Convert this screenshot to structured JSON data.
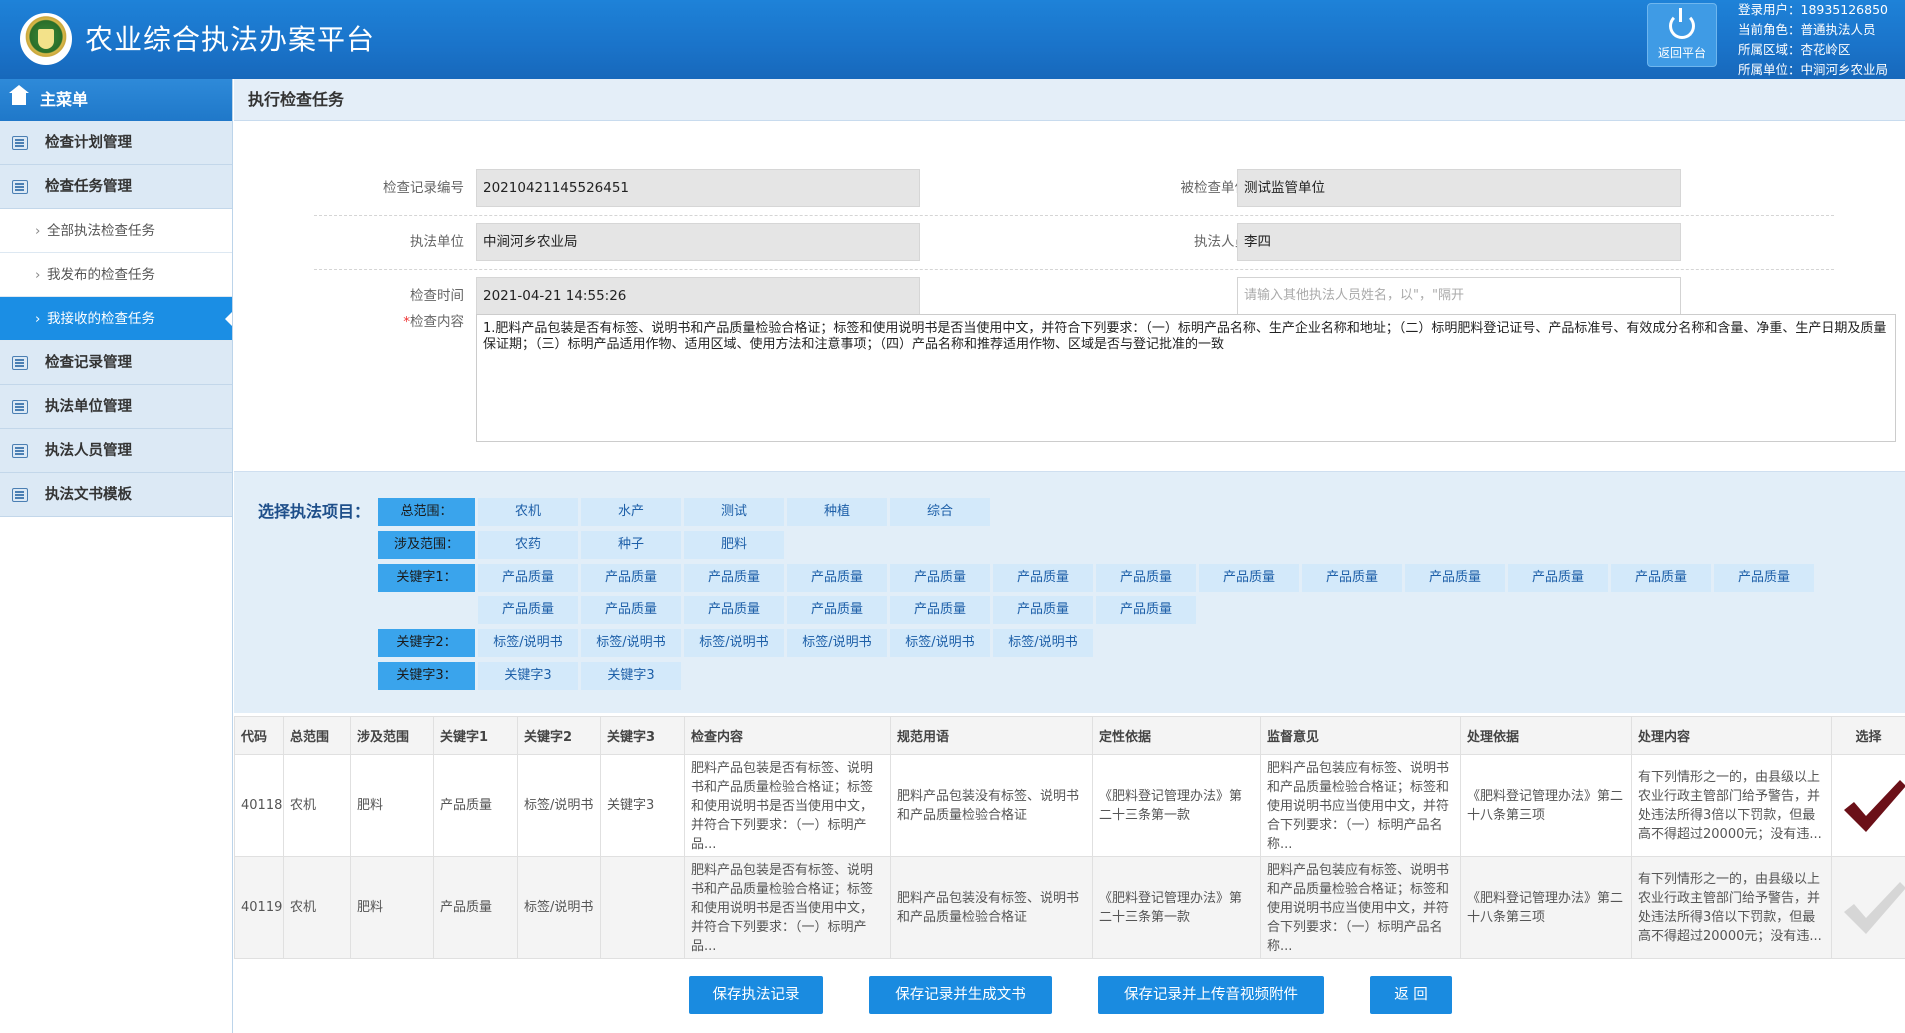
{
  "header": {
    "app_title": "农业综合执法办案平台",
    "return_label": "返回平台",
    "user_lines": [
      "登录用户：18935126850",
      "当前角色：普通执法人员",
      "所属区域：杏花岭区",
      "所属单位：中涧河乡农业局"
    ]
  },
  "sidebar": {
    "menu_title": "主菜单",
    "items": [
      {
        "label": "检查计划管理"
      },
      {
        "label": "检查任务管理"
      },
      {
        "label": "全部执法检查任务"
      },
      {
        "label": "我发布的检查任务"
      },
      {
        "label": "我接收的检查任务"
      },
      {
        "label": "检查记录管理"
      },
      {
        "label": "执法单位管理"
      },
      {
        "label": "执法人员管理"
      },
      {
        "label": "执法文书模板"
      }
    ]
  },
  "page_title": "执行检查任务",
  "form": {
    "record_no_label": "检查记录编号",
    "record_no": "20210421145526451",
    "inspected_label": "被检查单位",
    "inspected": "测试监管单位",
    "unit_label": "执法单位",
    "unit": "中涧河乡农业局",
    "staff_label": "执法人员",
    "staff": "李四",
    "time_label": "检查时间",
    "time": "2021-04-21 14:55:26",
    "other_staff_placeholder": "请输入其他执法人员姓名，以\"，\"隔开",
    "content_required": "*",
    "content_label": "检查内容",
    "content": "1.肥料产品包装是否有标签、说明书和产品质量检验合格证；标签和使用说明书是否当使用中文，并符合下列要求：（一）标明产品名称、生产企业名称和地址；（二）标明肥料登记证号、产品标准号、有效成分名称和含量、净重、生产日期及质量保证期；（三）标明产品适用作物、适用区域、使用方法和注意事项；（四）产品名称和推荐适用作物、区域是否与登记批准的一致"
  },
  "selection": {
    "title": "选择执法项目：",
    "rows": [
      {
        "head": "总范围：",
        "items": [
          "农机",
          "水产",
          "测试",
          "种植",
          "综合"
        ]
      },
      {
        "head": "涉及范围：",
        "items": [
          "农药",
          "种子",
          "肥料"
        ]
      },
      {
        "head": "关键字1：",
        "items": [
          "产品质量",
          "产品质量",
          "产品质量",
          "产品质量",
          "产品质量",
          "产品质量",
          "产品质量",
          "产品质量",
          "产品质量",
          "产品质量",
          "产品质量",
          "产品质量",
          "产品质量"
        ]
      },
      {
        "head": "",
        "items": [
          "产品质量",
          "产品质量",
          "产品质量",
          "产品质量",
          "产品质量",
          "产品质量",
          "产品质量"
        ]
      },
      {
        "head": "关键字2：",
        "items": [
          "标签/说明书",
          "标签/说明书",
          "标签/说明书",
          "标签/说明书",
          "标签/说明书",
          "标签/说明书"
        ]
      },
      {
        "head": "关键字3：",
        "items": [
          "关键字3",
          "关键字3"
        ]
      }
    ]
  },
  "table": {
    "headers": [
      "代码",
      "总范围",
      "涉及范围",
      "关键字1",
      "关键字2",
      "关键字3",
      "检查内容",
      "规范用语",
      "定性依据",
      "监督意见",
      "处理依据",
      "处理内容",
      "选择"
    ],
    "rows": [
      {
        "code": "40118",
        "scope": "农机",
        "range": "肥料",
        "kw1": "产品质量",
        "kw2": "标签/说明书",
        "kw3": "关键字3",
        "content": "肥料产品包装是否有标签、说明书和产品质量检验合格证；标签和使用说明书是否当使用中文，并符合下列要求：（一）标明产品...",
        "term": "肥料产品包装没有标签、说明书和产品质量检验合格证",
        "basis": "《肥料登记管理办法》第二十三条第一款",
        "opinion": "肥料产品包装应有标签、说明书和产品质量检验合格证；标签和使用说明书应当使用中文，并符合下列要求：（一）标明产品名称...",
        "handle_basis": "《肥料登记管理办法》第二十八条第三项",
        "handle_content": "有下列情形之一的，由县级以上农业行政主管部门给予警告，并处违法所得3倍以下罚款，但最高不得超过20000元；没有违...",
        "selected": true
      },
      {
        "code": "40119",
        "scope": "农机",
        "range": "肥料",
        "kw1": "产品质量",
        "kw2": "标签/说明书",
        "kw3": "",
        "content": "肥料产品包装是否有标签、说明书和产品质量检验合格证；标签和使用说明书是否当使用中文，并符合下列要求：（一）标明产品...",
        "term": "肥料产品包装没有标签、说明书和产品质量检验合格证",
        "basis": "《肥料登记管理办法》第二十三条第一款",
        "opinion": "肥料产品包装应有标签、说明书和产品质量检验合格证；标签和使用说明书应当使用中文，并符合下列要求：（一）标明产品名称...",
        "handle_basis": "《肥料登记管理办法》第二十八条第三项",
        "handle_content": "有下列情形之一的，由县级以上农业行政主管部门给予警告，并处违法所得3倍以下罚款，但最高不得超过20000元；没有违...",
        "selected": false
      }
    ]
  },
  "buttons": {
    "save": "保存执法记录",
    "save_doc": "保存记录并生成文书",
    "save_upload": "保存记录并上传音视频附件",
    "back": "返  回"
  },
  "colors": {
    "header": "#1a73c9",
    "active": "#1b8ee4",
    "checked": "#6b1018",
    "unchecked": "#d6d6d6"
  }
}
